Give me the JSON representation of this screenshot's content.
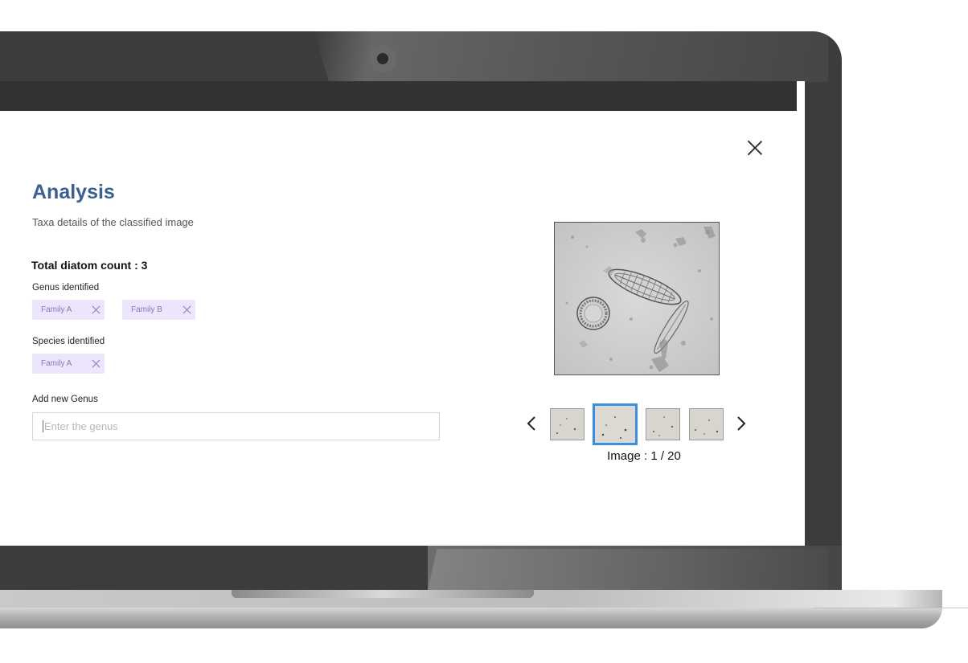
{
  "modal": {
    "title": "Analysis",
    "subtitle": "Taxa details of the classified image",
    "total_count": "Total diatom count : 3",
    "genus": {
      "label": "Genus identified",
      "chips": [
        "Family A",
        "Family B"
      ]
    },
    "species": {
      "label": "Species identified",
      "chips": [
        "Family A"
      ]
    },
    "add_genus": {
      "label": "Add new Genus",
      "placeholder": "Enter the genus",
      "value": ""
    }
  },
  "viewer": {
    "counter": "Image : 1 / 20",
    "thumbnail_count": 4,
    "active_thumbnail": 2
  },
  "colors": {
    "title": "#3b5f8e",
    "chip_bg": "#ece5fb",
    "chip_text": "#8a78b5",
    "active_thumb_border": "#3a8ee6"
  },
  "icons": [
    "close-icon",
    "chip-remove-icon",
    "chevron-left-icon",
    "chevron-right-icon",
    "camera"
  ]
}
